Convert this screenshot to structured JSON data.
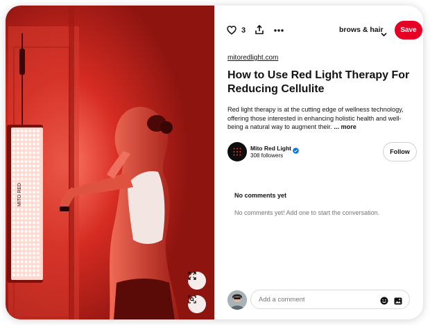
{
  "pin": {
    "image": {
      "description_icon": "red-light-panel-photo",
      "panel_lettering": "MITO RED",
      "accent": "#c8201a"
    },
    "photo_buttons": {
      "expand_icon": "expand-arrows-icon",
      "lens_icon": "visual-search-icon"
    }
  },
  "toolbar": {
    "like_count": "3",
    "board_name": "brows & hair",
    "save_label": "Save",
    "save_color": "#e60023"
  },
  "details": {
    "domain": "mitoredlight.com",
    "title": "How to Use Red Light Therapy For Reducing Cellulite",
    "description": "Red light therapy is at the cutting edge of wellness technology, offering those interested in enhancing holistic health and well-being a natural way to augment their.",
    "more_label": "... more"
  },
  "author": {
    "name": "Mito Red Light",
    "followers": "308 followers",
    "follow_label": "Follow"
  },
  "comments": {
    "heading": "No comments yet",
    "empty_text": "No comments yet! Add one to start the conversation."
  },
  "composer": {
    "placeholder": "Add a comment"
  }
}
